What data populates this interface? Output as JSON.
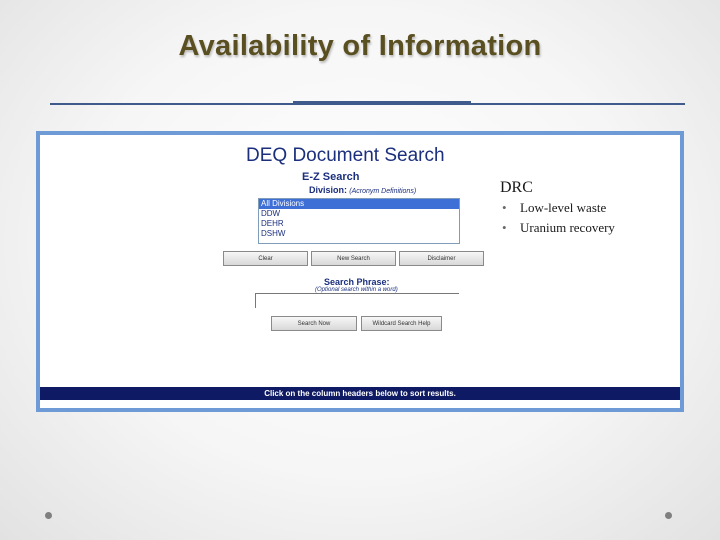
{
  "slide": {
    "title": "Availability of Information"
  },
  "search_panel": {
    "title": "DEQ Document Search",
    "ez_title": "E-Z Search",
    "division_label": "Division:",
    "division_hint": "(Acronym Definitions)",
    "division_options": [
      "All Divisions",
      "DDW",
      "DEHR",
      "DSHW"
    ],
    "selected_division": "All Divisions",
    "buttons": [
      "Clear",
      "New Search",
      "Disclaimer"
    ],
    "phrase_title": "Search Phrase:",
    "phrase_hint": "(Optional search within a word)",
    "phrase_value": "",
    "search_buttons": [
      "Search Now",
      "Wildcard Search Help"
    ],
    "sort_note": "Click on the column headers below to sort results."
  },
  "drc": {
    "heading": "DRC",
    "items": [
      "Low-level waste",
      "Uranium recovery"
    ]
  },
  "colors": {
    "title": "#5a4f20",
    "rule": "#3f5b8c",
    "frame": "#6e9ad6",
    "sort_bar": "#0e1a63",
    "selected": "#3d6fd6"
  }
}
